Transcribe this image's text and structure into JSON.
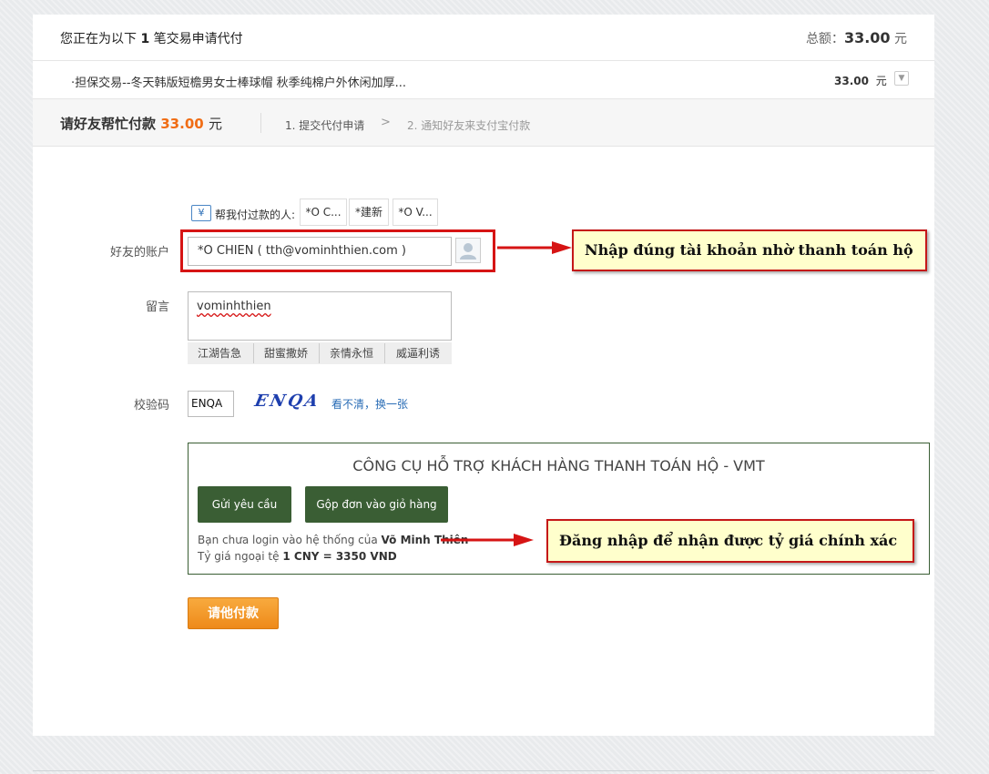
{
  "header": {
    "title_prefix": "您正在为以下",
    "title_count": "1",
    "title_suffix": "笔交易申请代付",
    "total_label": "总额：",
    "total_amount": "33.00",
    "total_unit": "元"
  },
  "order": {
    "name": "·担保交易--冬天韩版短檐男女士棒球帽 秋季纯棉户外休闲加厚...",
    "amount": "33.00",
    "unit": "元"
  },
  "step_bar": {
    "title": "请好友帮忙付款",
    "amount": "33.00",
    "unit": "元",
    "step1": "1. 提交代付申请",
    "arrow": ">",
    "step2": "2. 通知好友来支付宝付款"
  },
  "friends": {
    "label": "帮我付过款的人:",
    "icon_text": "¥",
    "tabs": [
      "*O C...",
      "*建新",
      "*O V..."
    ]
  },
  "form": {
    "account_label": "好友的账户",
    "account_value": "*O CHIEN ( tth@vominhthien.com )",
    "message_label": "留言",
    "message_value": "vominhthien",
    "quick_messages": [
      "江湖告急",
      "甜蜜撒娇",
      "亲情永恒",
      "威逼利诱"
    ],
    "captcha_label": "校验码",
    "captcha_value": "ENQA",
    "captcha_image_text": "ENQA",
    "captcha_refresh": "看不清，换一张"
  },
  "tool": {
    "title": "CÔNG CỤ HỖ TRỢ KHÁCH HÀNG THANH TOÁN HỘ - VMT",
    "send_button": "Gửi yêu cầu",
    "cart_button": "Gộp đơn vào giỏ hàng",
    "login_text": "Bạn chưa login vào hệ thống của",
    "login_name": "Võ Minh Thiên",
    "rate_text": "Tỷ giá ngoại tệ",
    "rate_value": "1 CNY = 3350 VND"
  },
  "submit_button": "请他付款",
  "annotations": {
    "account_note": "Nhập đúng tài khoản nhờ thanh toán hộ",
    "login_note": "Đăng nhập để nhận được tỷ giá chính xác"
  },
  "colors": {
    "accent_orange": "#f06d15",
    "button_orange": "#f49a2c",
    "tool_green": "#3a5e34",
    "annotation_red": "#d61414",
    "callout_yellow": "#ffffcc"
  },
  "icons": {
    "friend_icon": "currency-yen-icon",
    "contact_icon": "person-icon",
    "expand_icon": "chevron-down-icon"
  }
}
